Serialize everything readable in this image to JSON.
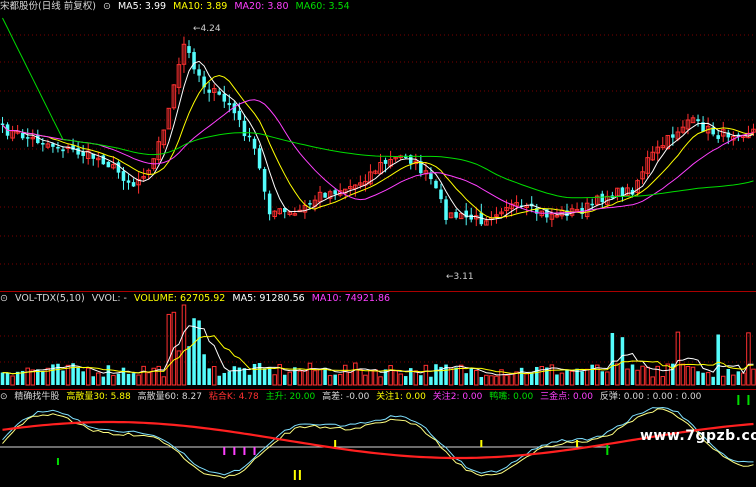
{
  "colors": {
    "up": "#ff3030",
    "down": "#54fcfc",
    "ma5": "#ffffff",
    "ma10": "#ffff00",
    "ma20": "#ff40ff",
    "ma60": "#00dd00",
    "grid": "#7a0000",
    "label": "#c8c8c8"
  },
  "main_legend": {
    "title": "宋都股份(日线 前复权)",
    "ma5": "MA5: 3.99",
    "ma10": "MA10: 3.89",
    "ma20": "MA20: 3.80",
    "ma60": "MA60: 3.54"
  },
  "annotations": {
    "high": "4.24",
    "low": "3.11"
  },
  "vol_legend": {
    "name": "VOL-TDX(5,10)",
    "vvol": "VVOL: -",
    "volume": "VOLUME: 62705.92",
    "ma5": "MA5: 91280.56",
    "ma10": "MA10: 74921.86"
  },
  "ind_legend": {
    "name": "精确找牛股",
    "a": "高散量30: 5.88",
    "b": "高散量60: 8.27",
    "c": "粘合K: 4.78",
    "d": "主升: 20.00",
    "e": "高差: -0.00",
    "f": "关注1: 0.00",
    "g": "关注2: 0.00",
    "h": "鸭嘴: 0.00",
    "i": "三金点: 0.00",
    "j": "反弹: 0.00 : 0.00 : 0.00"
  },
  "watermark": "www.7gpzb.com",
  "chart_data": [
    {
      "type": "candlestick",
      "title": "宋都股份(日线 前复权)",
      "y_range": [
        3.11,
        4.24
      ],
      "high_label": 4.24,
      "low_label": 3.11,
      "moving_averages": {
        "MA5": 3.99,
        "MA10": 3.89,
        "MA20": 3.8,
        "MA60": 3.54
      }
    },
    {
      "type": "bar",
      "title": "VOL-TDX(5,10)",
      "series": [
        {
          "name": "VOLUME",
          "values": [
            62705.92
          ]
        },
        {
          "name": "MA5",
          "values": [
            91280.56
          ]
        },
        {
          "name": "MA10",
          "values": [
            74921.86
          ]
        }
      ]
    },
    {
      "type": "line",
      "title": "精确找牛股",
      "values": {
        "高散量30": 5.88,
        "高散量60": 8.27,
        "粘合K": 4.78,
        "主升": 20.0,
        "高差": -0.0
      }
    }
  ]
}
